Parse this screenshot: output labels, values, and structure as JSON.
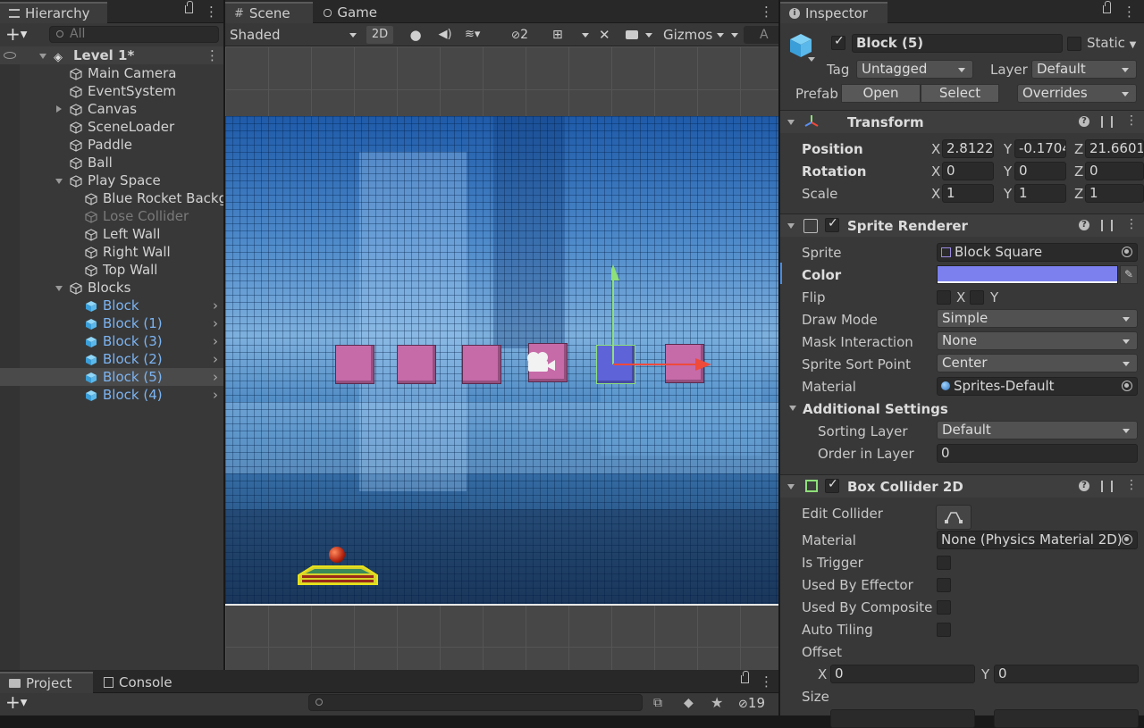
{
  "hierarchy": {
    "tab": "Hierarchy",
    "search_placeholder": "All",
    "scene_name": "Level 1*",
    "items": [
      {
        "label": "Main Camera"
      },
      {
        "label": "EventSystem"
      },
      {
        "label": "Canvas"
      },
      {
        "label": "SceneLoader"
      },
      {
        "label": "Paddle"
      },
      {
        "label": "Ball"
      },
      {
        "label": "Play Space"
      },
      {
        "label": "Blue Rocket Backg"
      },
      {
        "label": "Lose Collider"
      },
      {
        "label": "Left Wall"
      },
      {
        "label": "Right Wall"
      },
      {
        "label": "Top Wall"
      },
      {
        "label": "Blocks"
      },
      {
        "label": "Block"
      },
      {
        "label": "Block (1)"
      },
      {
        "label": "Block (3)"
      },
      {
        "label": "Block (2)"
      },
      {
        "label": "Block (5)"
      },
      {
        "label": "Block (4)"
      }
    ]
  },
  "scene": {
    "tab_scene": "Scene",
    "tab_game": "Game",
    "shading": "Shaded",
    "mode_2d": "2D",
    "hidden_count": "2",
    "gizmos": "Gizmos",
    "search_glyph": "A",
    "selected_color": "#6670e6"
  },
  "inspector": {
    "tab": "Inspector",
    "object_name": "Block (5)",
    "static_label": "Static",
    "tag_label": "Tag",
    "tag_value": "Untagged",
    "layer_label": "Layer",
    "layer_value": "Default",
    "prefab_label": "Prefab",
    "open_btn": "Open",
    "select_btn": "Select",
    "overrides_btn": "Overrides",
    "transform": {
      "title": "Transform",
      "position_label": "Position",
      "rotation_label": "Rotation",
      "scale_label": "Scale",
      "pos": {
        "x": "2.8122",
        "y": "-0.1704",
        "z": "21.6601"
      },
      "rot": {
        "x": "0",
        "y": "0",
        "z": "0"
      },
      "scale": {
        "x": "1",
        "y": "1",
        "z": "1"
      }
    },
    "axis": {
      "x": "X",
      "y": "Y",
      "z": "Z"
    },
    "sprite_renderer": {
      "title": "Sprite Renderer",
      "sprite_label": "Sprite",
      "sprite_value": "Block Square",
      "color_label": "Color",
      "color_value": "#7b80ee",
      "flip_label": "Flip",
      "flip_x": "X",
      "flip_y": "Y",
      "draw_mode_label": "Draw Mode",
      "draw_mode_value": "Simple",
      "mask_label": "Mask Interaction",
      "mask_value": "None",
      "sort_point_label": "Sprite Sort Point",
      "sort_point_value": "Center",
      "material_label": "Material",
      "material_value": "Sprites-Default",
      "additional": "Additional Settings",
      "sorting_layer_label": "Sorting Layer",
      "sorting_layer_value": "Default",
      "order_label": "Order in Layer",
      "order_value": "0"
    },
    "box_collider": {
      "title": "Box Collider 2D",
      "edit_label": "Edit Collider",
      "material_label": "Material",
      "material_value": "None (Physics Material 2D)",
      "trigger_label": "Is Trigger",
      "effector_label": "Used By Effector",
      "composite_label": "Used By Composite",
      "tiling_label": "Auto Tiling",
      "offset_label": "Offset",
      "offset_x": "0",
      "offset_y": "0",
      "size_label": "Size"
    }
  },
  "project": {
    "tab_project": "Project",
    "tab_console": "Console",
    "hidden_count": "19"
  }
}
